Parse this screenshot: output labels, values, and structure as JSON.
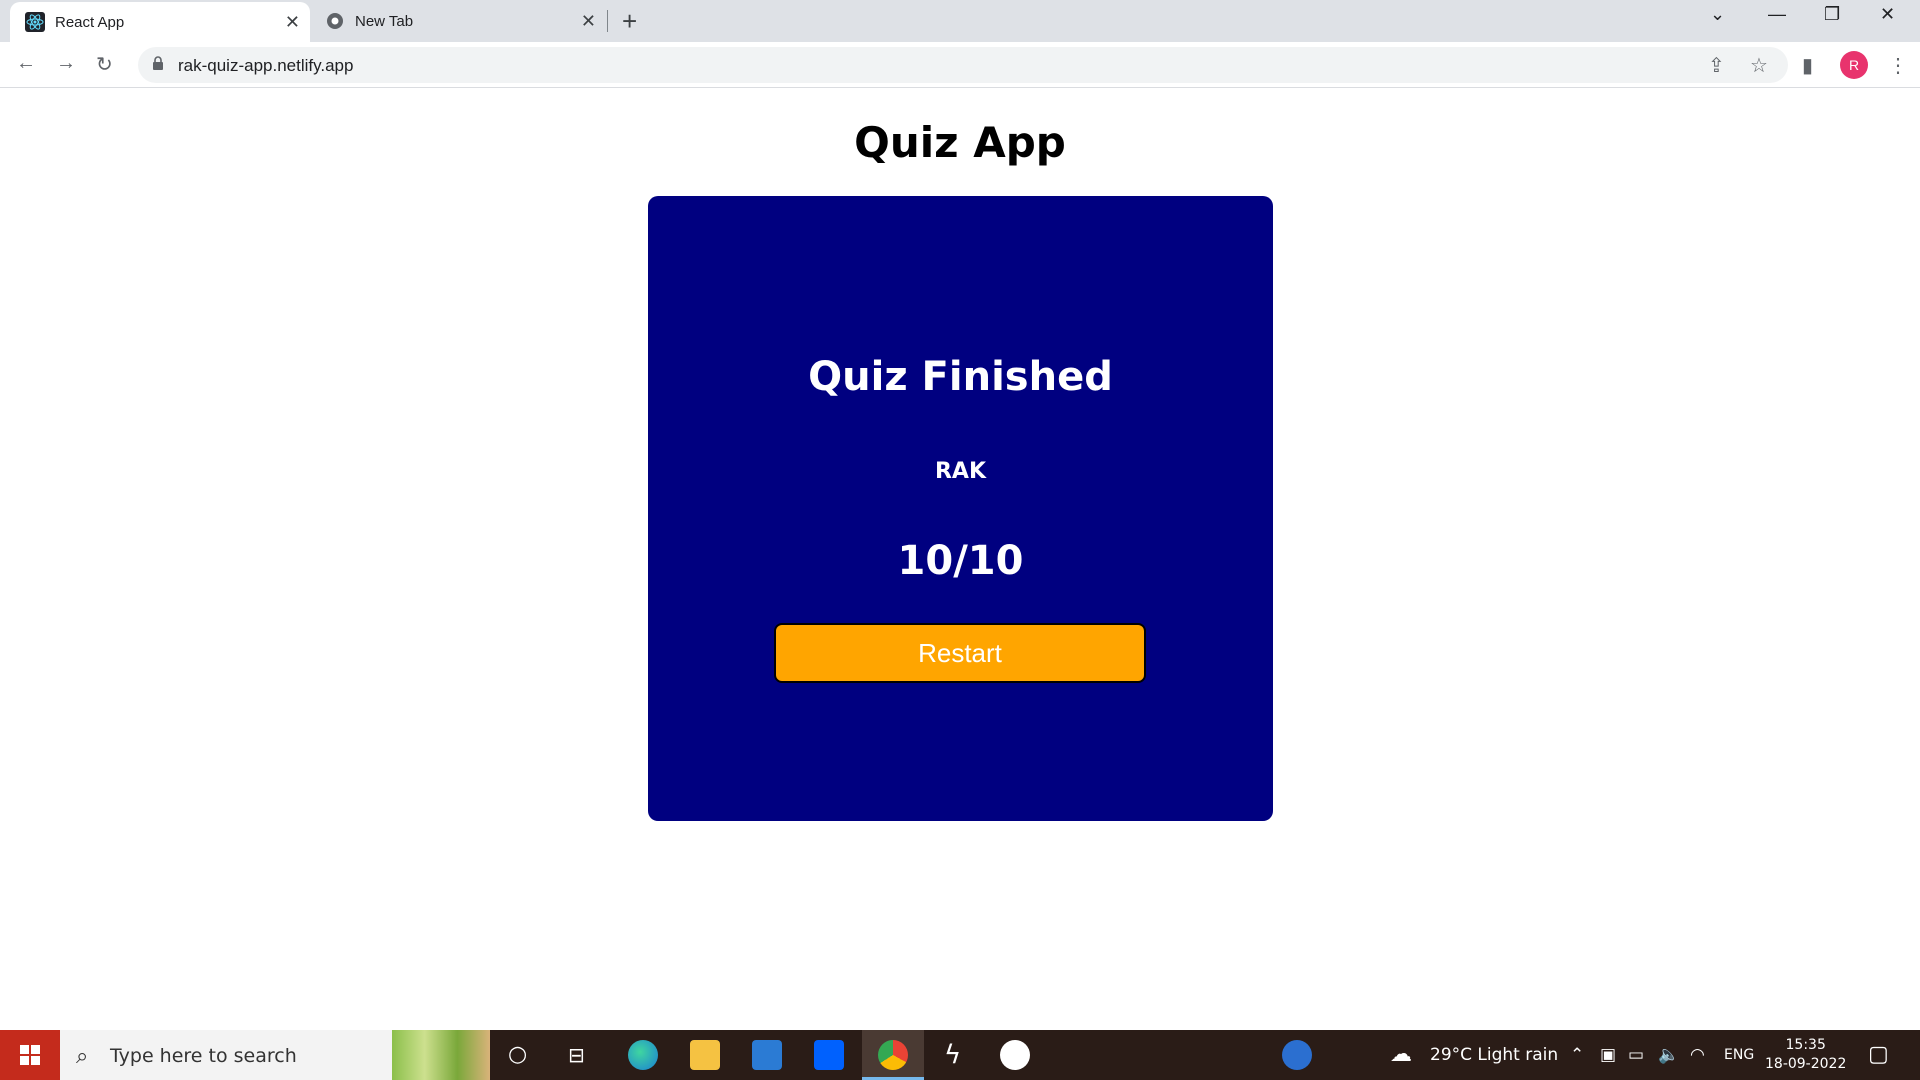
{
  "browser": {
    "tabs": [
      {
        "title": "React App",
        "active": true
      },
      {
        "title": "New Tab",
        "active": false
      }
    ],
    "url": "rak-quiz-app.netlify.app",
    "profile_initial": "R",
    "profile_color": "#e8336d"
  },
  "page": {
    "title": "Quiz App",
    "card": {
      "heading": "Quiz Finished",
      "player_name": "RAK",
      "score": "10/10",
      "restart_label": "Restart",
      "background_color": "#000080",
      "button_color": "#ffa500"
    }
  },
  "taskbar": {
    "search_placeholder": "Type here to search",
    "weather": "29°C  Light rain",
    "language": "ENG",
    "time": "15:35",
    "date": "18-09-2022",
    "apps": [
      "cortana-icon",
      "task-view-icon",
      "edge-icon",
      "file-explorer-icon",
      "mail-icon",
      "dropbox-icon",
      "chrome-icon",
      "app-icon",
      "word-icon"
    ]
  }
}
